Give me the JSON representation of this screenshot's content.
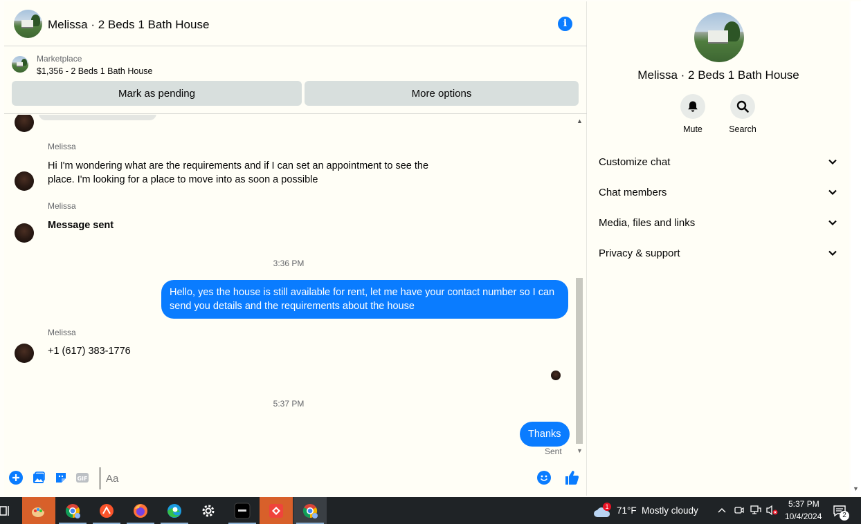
{
  "chat_header": {
    "title": "Melissa · 2 Beds 1 Bath House"
  },
  "marketplace": {
    "label": "Marketplace",
    "listing": "$1,356 - 2 Beds 1 Bath House",
    "pending_button": "Mark as pending",
    "more_button": "More options"
  },
  "messages": {
    "sender_1": "Melissa",
    "text_1": "Hi I'm wondering what are the requirements and if I can set an appointment to see the place. I'm looking for a place to move into as soon a possible",
    "sender_2": "Melissa",
    "text_2": "Message sent",
    "time_1": "3:36 PM",
    "outgoing_1": "Hello, yes the house is still available for rent, let me have your contact number so I can send you details and the requirements about the house",
    "sender_3": "Melissa",
    "text_3": "+1 (617) 383-1776",
    "time_2": "5:37 PM",
    "outgoing_2": "Thanks",
    "status": "Sent"
  },
  "composer": {
    "placeholder": "Aa"
  },
  "info_panel": {
    "title": "Melissa · 2 Beds 1 Bath House",
    "actions": [
      {
        "label": "Mute",
        "icon": "bell-icon"
      },
      {
        "label": "Search",
        "icon": "search-icon"
      }
    ],
    "sections": [
      {
        "label": "Customize chat"
      },
      {
        "label": "Chat members"
      },
      {
        "label": "Media, files and links"
      },
      {
        "label": "Privacy & support"
      }
    ]
  },
  "taskbar": {
    "weather_badge": "1",
    "weather_temp": "71°F",
    "weather_desc": "Mostly cloudy",
    "time": "5:37 PM",
    "date": "10/4/2024",
    "notification_count": "2"
  },
  "colors": {
    "messenger_blue": "#0a7cff",
    "button_gray": "#d8dfdd",
    "taskbar_bg": "#1f2326",
    "active_task": "#d8602a"
  }
}
